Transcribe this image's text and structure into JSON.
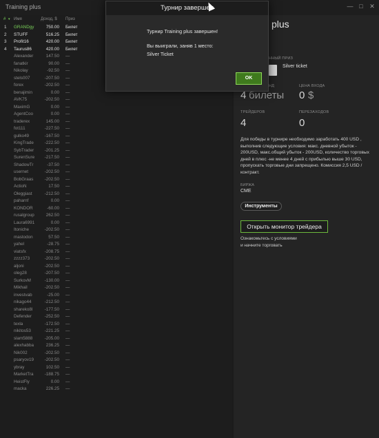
{
  "window": {
    "title": "Training plus",
    "controls": [
      "—",
      "□",
      "✕"
    ]
  },
  "leaderboard": {
    "headers": {
      "rank": "#",
      "name": "Имя",
      "income": "Доход, $",
      "prize": "Приз"
    },
    "rows": [
      {
        "rank": "1",
        "name": "GRANDgy",
        "income": "750.00",
        "prize": "Билет"
      },
      {
        "rank": "2",
        "name": "STUFF",
        "income": "516.25",
        "prize": "Билет"
      },
      {
        "rank": "3",
        "name": "Profit16",
        "income": "420.00",
        "prize": "Билет"
      },
      {
        "rank": "4",
        "name": "Taurus86",
        "income": "420.00",
        "prize": "Билет"
      },
      {
        "rank": "",
        "name": "Alexander",
        "income": "147.50",
        "prize": "—"
      },
      {
        "rank": "",
        "name": "fanatkir",
        "income": "90.00",
        "prize": "—"
      },
      {
        "rank": "",
        "name": "Nikolay",
        "income": "-92.50",
        "prize": "—"
      },
      {
        "rank": "",
        "name": "stels007",
        "income": "-207.50",
        "prize": "—"
      },
      {
        "rank": "",
        "name": "forex",
        "income": "-202.50",
        "prize": "—"
      },
      {
        "rank": "",
        "name": "benajimin",
        "income": "0.00",
        "prize": "—"
      },
      {
        "rank": "",
        "name": "AVK75",
        "income": "-202.50",
        "prize": "—"
      },
      {
        "rank": "",
        "name": "MaximG",
        "income": "0.00",
        "prize": "—"
      },
      {
        "rank": "",
        "name": "AgentCoo",
        "income": "0.00",
        "prize": "—"
      },
      {
        "rank": "",
        "name": "traderex",
        "income": "145.00",
        "prize": "—"
      },
      {
        "rank": "",
        "name": "fot111",
        "income": "-227.50",
        "prize": "—"
      },
      {
        "rank": "",
        "name": "gulko49",
        "income": "-167.50",
        "prize": "—"
      },
      {
        "rank": "",
        "name": "KingTrade",
        "income": "-222.50",
        "prize": "—"
      },
      {
        "rank": "",
        "name": "SybTrader",
        "income": "-201.25",
        "prize": "—"
      },
      {
        "rank": "",
        "name": "SurenSure",
        "income": "-217.50",
        "prize": "—"
      },
      {
        "rank": "",
        "name": "ShadowTr",
        "income": "-37.50",
        "prize": "—"
      },
      {
        "rank": "",
        "name": "usernet",
        "income": "-202.50",
        "prize": "—"
      },
      {
        "rank": "",
        "name": "BobGraas",
        "income": "-202.50",
        "prize": "—"
      },
      {
        "rank": "",
        "name": "ActioN",
        "income": "17.50",
        "prize": "—"
      },
      {
        "rank": "",
        "name": "Oleggiast",
        "income": "-212.50",
        "prize": "—"
      },
      {
        "rank": "",
        "name": "paharnf",
        "income": "0.00",
        "prize": "—"
      },
      {
        "rank": "",
        "name": "KONDOR",
        "income": "-60.00",
        "prize": "—"
      },
      {
        "rank": "",
        "name": "rusalgroup",
        "income": "262.50",
        "prize": "—"
      },
      {
        "rank": "",
        "name": "Laura6991",
        "income": "0.00",
        "prize": "—"
      },
      {
        "rank": "",
        "name": "Itoniche",
        "income": "-202.50",
        "prize": "—"
      },
      {
        "rank": "",
        "name": "mastodon",
        "income": "57.50",
        "prize": "—"
      },
      {
        "rank": "",
        "name": "yahel",
        "income": "-28.75",
        "prize": "—"
      },
      {
        "rank": "",
        "name": "viatsfx",
        "income": "-208.75",
        "prize": "—"
      },
      {
        "rank": "",
        "name": "zzzz373",
        "income": "-202.50",
        "prize": "—"
      },
      {
        "rank": "",
        "name": "aljoni",
        "income": "-202.50",
        "prize": "—"
      },
      {
        "rank": "",
        "name": "oleg28",
        "income": "-207.50",
        "prize": "—"
      },
      {
        "rank": "",
        "name": "SurkovM",
        "income": "-130.00",
        "prize": "—"
      },
      {
        "rank": "",
        "name": "Mikhail",
        "income": "-202.50",
        "prize": "—"
      },
      {
        "rank": "",
        "name": "investvab",
        "income": "-25.00",
        "prize": "—"
      },
      {
        "rank": "",
        "name": "nikago44",
        "income": "-212.50",
        "prize": "—"
      },
      {
        "rank": "",
        "name": "shareko8l",
        "income": "-177.50",
        "prize": "—"
      },
      {
        "rank": "",
        "name": "Defender",
        "income": "-252.50",
        "prize": "—"
      },
      {
        "rank": "",
        "name": "texla",
        "income": "-172.50",
        "prize": "—"
      },
      {
        "rank": "",
        "name": "nikitos53",
        "income": "-221.25",
        "prize": "—"
      },
      {
        "rank": "",
        "name": "slam5888",
        "income": "-205.00",
        "prize": "—"
      },
      {
        "rank": "",
        "name": "alexhabba",
        "income": "236.25",
        "prize": "—"
      },
      {
        "rank": "",
        "name": "Nik002",
        "income": "-202.50",
        "prize": "—"
      },
      {
        "rank": "",
        "name": "psaryov19",
        "income": "-202.50",
        "prize": "—"
      },
      {
        "rank": "",
        "name": "ybray",
        "income": "102.50",
        "prize": "—"
      },
      {
        "rank": "",
        "name": "MarketTra",
        "income": "-188.75",
        "prize": "—"
      },
      {
        "rank": "",
        "name": "HeistFly",
        "income": "0.00",
        "prize": "—"
      },
      {
        "rank": "",
        "name": "macka",
        "income": "226.25",
        "prize": "—"
      }
    ]
  },
  "details": {
    "tournament_name": "plus",
    "prize_label": "ННЫЙ ПРИЗ",
    "prize_value": "Silver ticket",
    "entry_label_left": "НД",
    "entry_price_label": "ЦЕНА ВХОДА",
    "tickets_value": "4",
    "tickets_unit": "билеты",
    "entry_price_value": "0",
    "currency": "$",
    "traders_label": "ТРЕЙДЕРОВ",
    "traders_value": "4",
    "rebuys_label": "ПЕРЕЗАХОДОВ",
    "rebuys_value": "0",
    "description": "Для победы в турнире необходимо заработать 400 USD , выполнив следующие условия: макс. дневной убыток - 200USD, макс.общий убыток - 200USD, количество торговых дней в плюс -не менее 4 дней с прибылью выше 30 USD, пропускать торговые дни запрещено. Комиссия 2,5 USD / контракт.",
    "exchange_label": "БИРЖА",
    "exchange_value": "CME",
    "instruments_button": "Инструменты",
    "monitor_button": "Открыть монитор трейдера",
    "monitor_note": "Ознакомьтесь с условиями\nи начните торговать"
  },
  "modal": {
    "title": "Турнир завершен",
    "line1": "Турнир Training plus завершен!",
    "line2": "Вы выиграли, заняв 1 место:",
    "line3": "Silver Ticket",
    "ok_label": "OK"
  },
  "colors": {
    "accent_green": "#7bd35a",
    "ok_button_bg": "#3f7a1d",
    "monitor_button_border": "#6dbb3c"
  }
}
